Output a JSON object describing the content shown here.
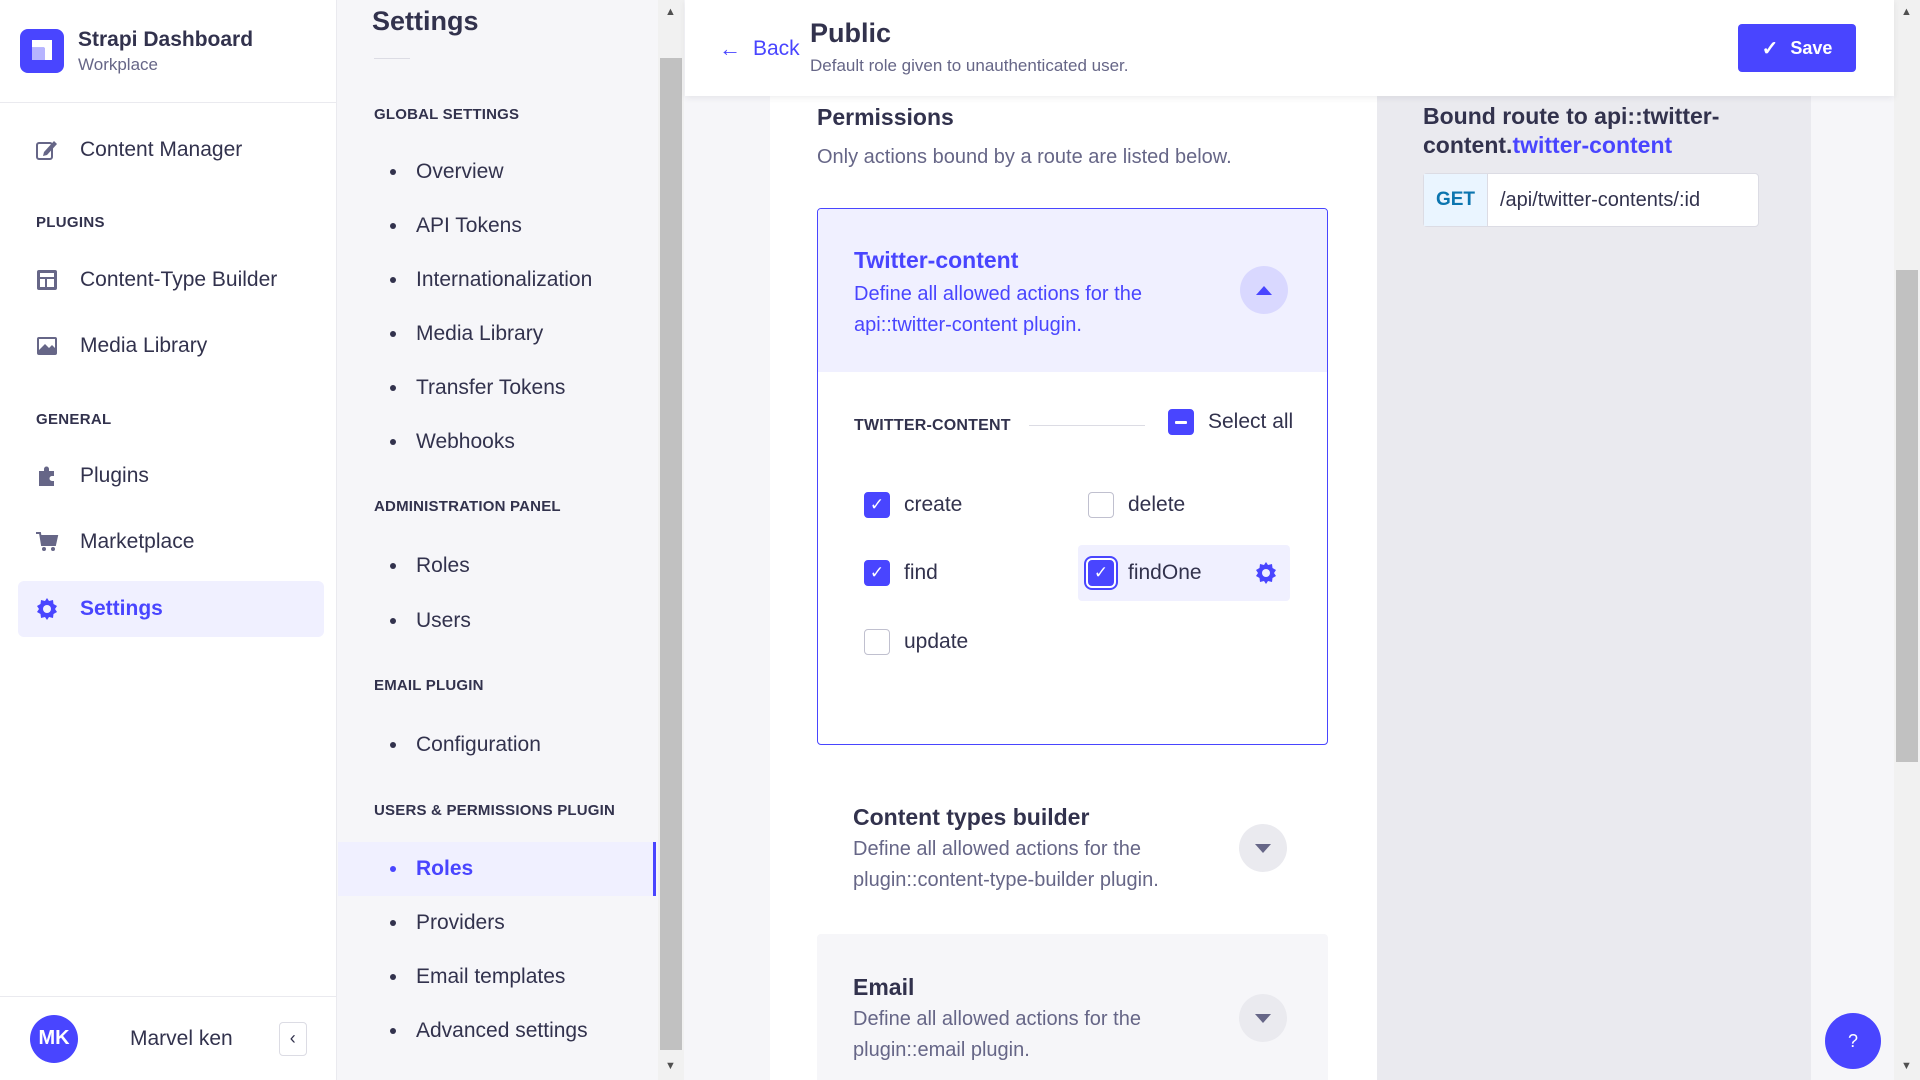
{
  "brand": {
    "name": "Strapi Dashboard",
    "workplace": "Workplace"
  },
  "main_nav": {
    "content_manager": "Content Manager",
    "plugins_section": "PLUGINS",
    "content_type_builder": "Content-Type Builder",
    "media_library": "Media Library",
    "general_section": "GENERAL",
    "plugins": "Plugins",
    "marketplace": "Marketplace",
    "settings": "Settings"
  },
  "user": {
    "initials": "MK",
    "name": "Marvel ken"
  },
  "settings_nav": {
    "title": "Settings",
    "global_section": "GLOBAL SETTINGS",
    "global_items": [
      "Overview",
      "API Tokens",
      "Internationalization",
      "Media Library",
      "Transfer Tokens",
      "Webhooks"
    ],
    "admin_section": "ADMINISTRATION PANEL",
    "admin_items": [
      "Roles",
      "Users"
    ],
    "email_section": "EMAIL PLUGIN",
    "email_items": [
      "Configuration"
    ],
    "up_section": "USERS & PERMISSIONS PLUGIN",
    "up_items": [
      "Roles",
      "Providers",
      "Email templates",
      "Advanced settings"
    ],
    "active_item": "Roles"
  },
  "header": {
    "back_label": "Back",
    "title": "Public",
    "description": "Default role given to unauthenticated user.",
    "save_label": "Save"
  },
  "permissions": {
    "title": "Permissions",
    "subtitle": "Only actions bound by a route are listed below.",
    "twitter": {
      "title": "Twitter-content",
      "description": "Define all allowed actions for the api::twitter-content plugin.",
      "group_label": "TWITTER-CONTENT",
      "select_all": "Select all",
      "actions": [
        {
          "label": "create",
          "checked": true
        },
        {
          "label": "delete",
          "checked": false
        },
        {
          "label": "find",
          "checked": true
        },
        {
          "label": "findOne",
          "checked": true
        },
        {
          "label": "update",
          "checked": false
        }
      ]
    },
    "ctb": {
      "title": "Content types builder",
      "description": "Define all allowed actions for the plugin::content-type-builder plugin."
    },
    "email": {
      "title": "Email",
      "description": "Define all allowed actions for the plugin::email plugin."
    }
  },
  "route": {
    "title_prefix": "Bound route to api::twitter-content.",
    "title_highlight": "twitter-content",
    "method": "GET",
    "path": "/api/twitter-contents/:id"
  },
  "help": {
    "label": "?"
  },
  "colors": {
    "primary": "#4945ff",
    "primary_light": "#f0f0ff",
    "neutral": "#32324d"
  }
}
